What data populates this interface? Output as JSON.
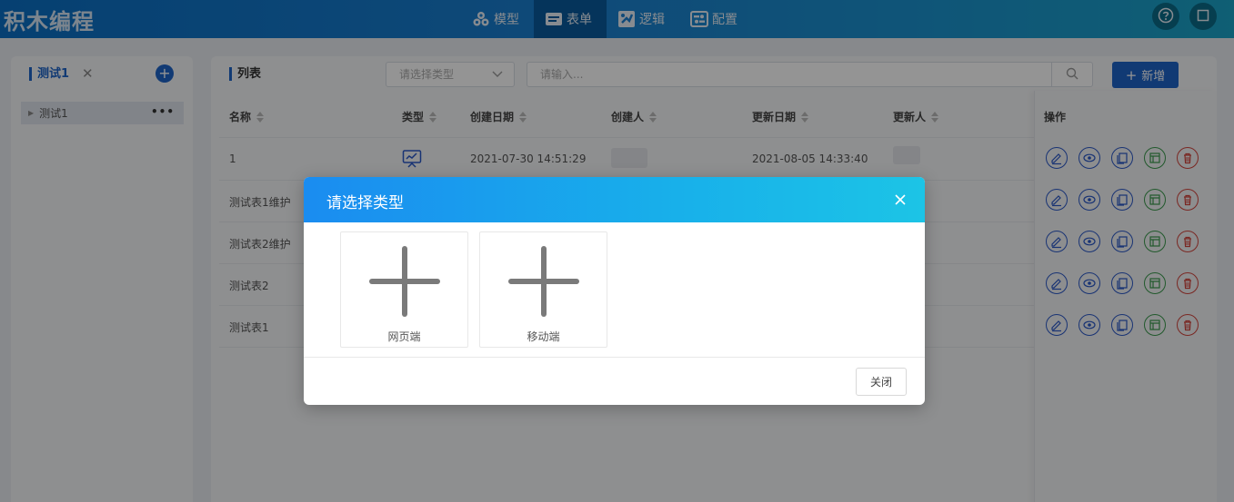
{
  "header": {
    "brand": "积木编程",
    "nav": [
      {
        "label": "模型",
        "icon": "cubes-icon"
      },
      {
        "label": "表单",
        "icon": "form-icon",
        "active": true
      },
      {
        "label": "逻辑",
        "icon": "logic-icon"
      },
      {
        "label": "配置",
        "icon": "config-icon"
      }
    ],
    "help_icon": "help-icon",
    "window_icon": "window-icon"
  },
  "sidebar": {
    "tab_label": "测试1",
    "tree": [
      {
        "label": "测试1"
      }
    ]
  },
  "main": {
    "title": "列表",
    "type_select_placeholder": "请选择类型",
    "search_placeholder": "请输入...",
    "add_label": "新增",
    "columns": [
      "名称",
      "类型",
      "创建日期",
      "创建人",
      "更新日期",
      "更新人"
    ],
    "op_header": "操作",
    "rows": [
      {
        "name": "1",
        "created": "2021-07-30 14:51:29",
        "updated": "2021-08-05 14:33:40"
      },
      {
        "name": "测试表1维护"
      },
      {
        "name": "测试表2维护"
      },
      {
        "name": "测试表2"
      },
      {
        "name": "测试表1"
      }
    ]
  },
  "modal": {
    "title": "请选择类型",
    "options": [
      {
        "label": "网页端"
      },
      {
        "label": "移动端"
      }
    ],
    "close_label": "关闭"
  },
  "colors": {
    "accent": "#1e64c8",
    "header_start": "#0b6fc4",
    "header_end": "#1aa4c8",
    "success": "#3a9a4c",
    "danger": "#d2443c"
  }
}
